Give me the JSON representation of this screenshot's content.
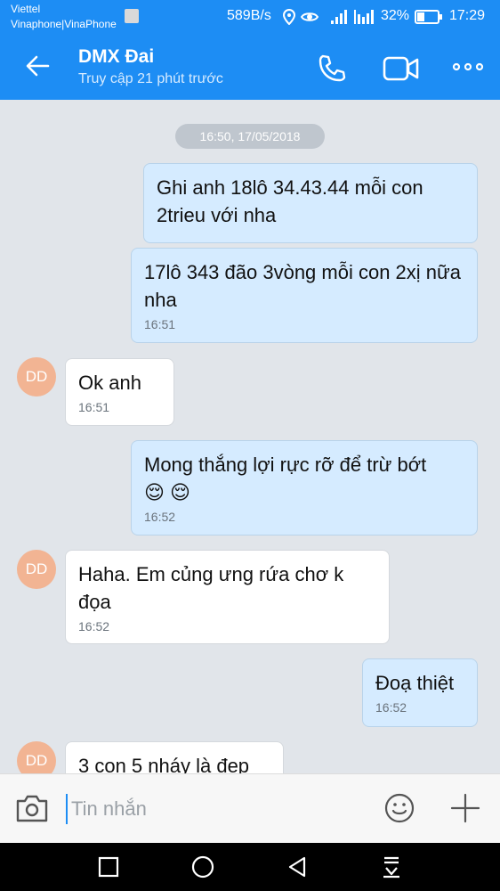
{
  "status_bar": {
    "carrier_primary": "Viettel",
    "carrier_secondary": "Vinaphone|VinaPhone",
    "net_speed": "589B/s",
    "battery": "32%",
    "time": "17:29"
  },
  "header": {
    "title": "DMX Đai",
    "subtitle": "Truy cập 21 phút trước"
  },
  "chat": {
    "date_separator": "16:50, 17/05/2018",
    "avatar_initials": "DD",
    "messages": [
      {
        "direction": "out",
        "text": "Ghi anh 18lô 34.43.44 mỗi con 2trieu với nha",
        "time": ""
      },
      {
        "direction": "out",
        "text": "17lô 343 đão 3vòng mỗi con 2xị nữa nha",
        "time": "16:51"
      },
      {
        "direction": "in",
        "text": "Ok anh",
        "time": "16:51"
      },
      {
        "direction": "out",
        "text": "Mong thắng lợi rực rỡ để trừ bớt",
        "emoji": "😌 😌",
        "time": "16:52"
      },
      {
        "direction": "in",
        "text": "Haha. Em củng ưng rứa chơ k đọa",
        "time": "16:52"
      },
      {
        "direction": "out",
        "text": "Đoạ thiệt",
        "time": "16:52"
      },
      {
        "direction": "in",
        "text": "3 con 5 nháy là đẹp",
        "time": ""
      }
    ]
  },
  "composer": {
    "placeholder": "Tin nhắn"
  },
  "colors": {
    "brand_blue": "#1d8df4",
    "outgoing_bubble": "#d5ebff",
    "incoming_bubble": "#ffffff",
    "avatar_bg": "#f2b493"
  }
}
